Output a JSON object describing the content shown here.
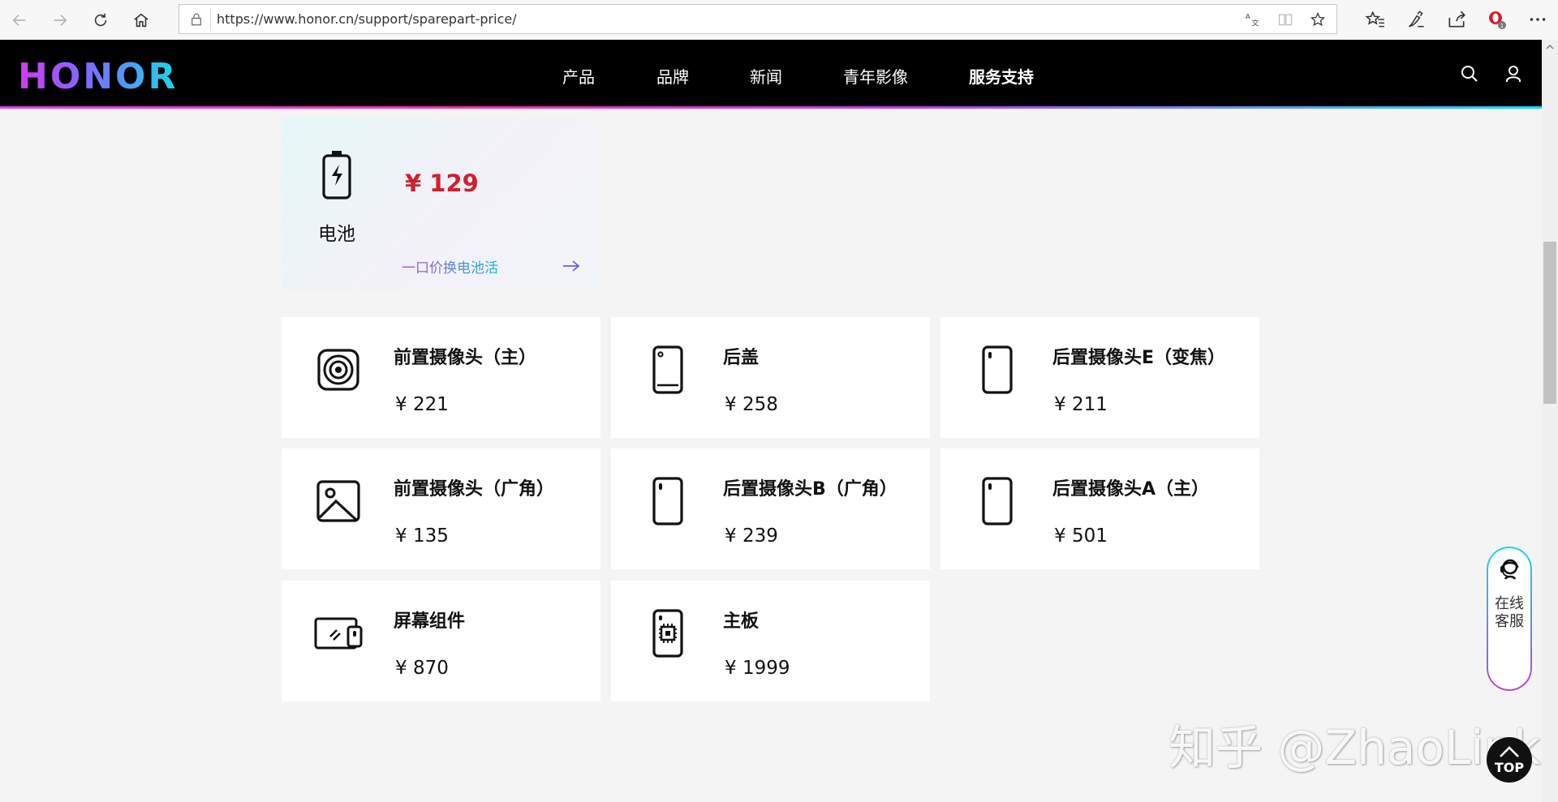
{
  "browser": {
    "url": "https://www.honor.cn/support/sparepart-price/"
  },
  "header": {
    "logo": "HONOR",
    "menu": [
      {
        "label": "产品"
      },
      {
        "label": "品牌"
      },
      {
        "label": "新闻"
      },
      {
        "label": "青年影像"
      },
      {
        "label": "服务支持"
      }
    ],
    "active_menu": "服务支持"
  },
  "battery": {
    "name": "电池",
    "price": "¥ 129",
    "promo": "一口价换电池活",
    "price_color": "#d0202e"
  },
  "parts": [
    {
      "name": "前置摄像头（主）",
      "price": "¥ 221",
      "icon": "front-camera-icon"
    },
    {
      "name": "后盖",
      "price": "¥ 258",
      "icon": "back-cover-icon"
    },
    {
      "name": "后置摄像头E（变焦）",
      "price": "¥ 211",
      "icon": "rear-camera-icon"
    },
    {
      "name": "前置摄像头（广角）",
      "price": "¥ 135",
      "icon": "wide-angle-image-icon"
    },
    {
      "name": "后置摄像头B（广角）",
      "price": "¥ 239",
      "icon": "rear-camera-icon"
    },
    {
      "name": "后置摄像头A（主）",
      "price": "¥ 501",
      "icon": "rear-camera-icon"
    },
    {
      "name": "屏幕组件",
      "price": "¥ 870",
      "icon": "screen-assembly-icon"
    },
    {
      "name": "主板",
      "price": "¥ 1999",
      "icon": "mainboard-icon"
    }
  ],
  "support_widget": {
    "label": "在线客服"
  },
  "back_to_top": {
    "label": "TOP"
  },
  "watermark": "知乎 @ZhaoLink",
  "colors": {
    "accent_gradient_start": "#d03cf0",
    "accent_gradient_end": "#18d8e8",
    "header_bg": "#000000",
    "page_bg": "#f4f4f4"
  }
}
